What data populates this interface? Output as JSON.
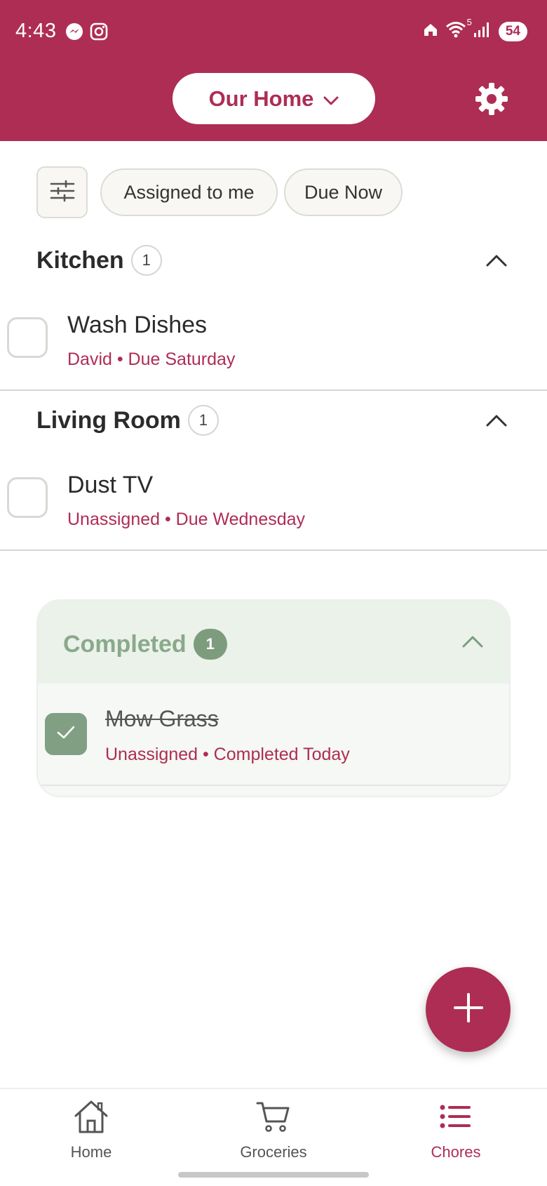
{
  "status_bar": {
    "time": "4:43",
    "battery": "54",
    "wifi_label": "5"
  },
  "header": {
    "home_selector": "Our Home",
    "accent_color": "#AE2D55"
  },
  "filters": {
    "assigned_to_me": "Assigned to me",
    "due_now": "Due Now"
  },
  "sections": [
    {
      "name": "Kitchen",
      "count": "1",
      "chores": [
        {
          "title": "Wash Dishes",
          "meta": "David • Due Saturday"
        }
      ]
    },
    {
      "name": "Living Room",
      "count": "1",
      "chores": [
        {
          "title": "Dust TV",
          "meta": "Unassigned • Due Wednesday"
        }
      ]
    }
  ],
  "completed": {
    "title": "Completed",
    "count": "1",
    "items": [
      {
        "title": "Mow Grass",
        "meta": "Unassigned • Completed Today"
      }
    ]
  },
  "bottom_nav": {
    "home": "Home",
    "groceries": "Groceries",
    "chores": "Chores"
  }
}
